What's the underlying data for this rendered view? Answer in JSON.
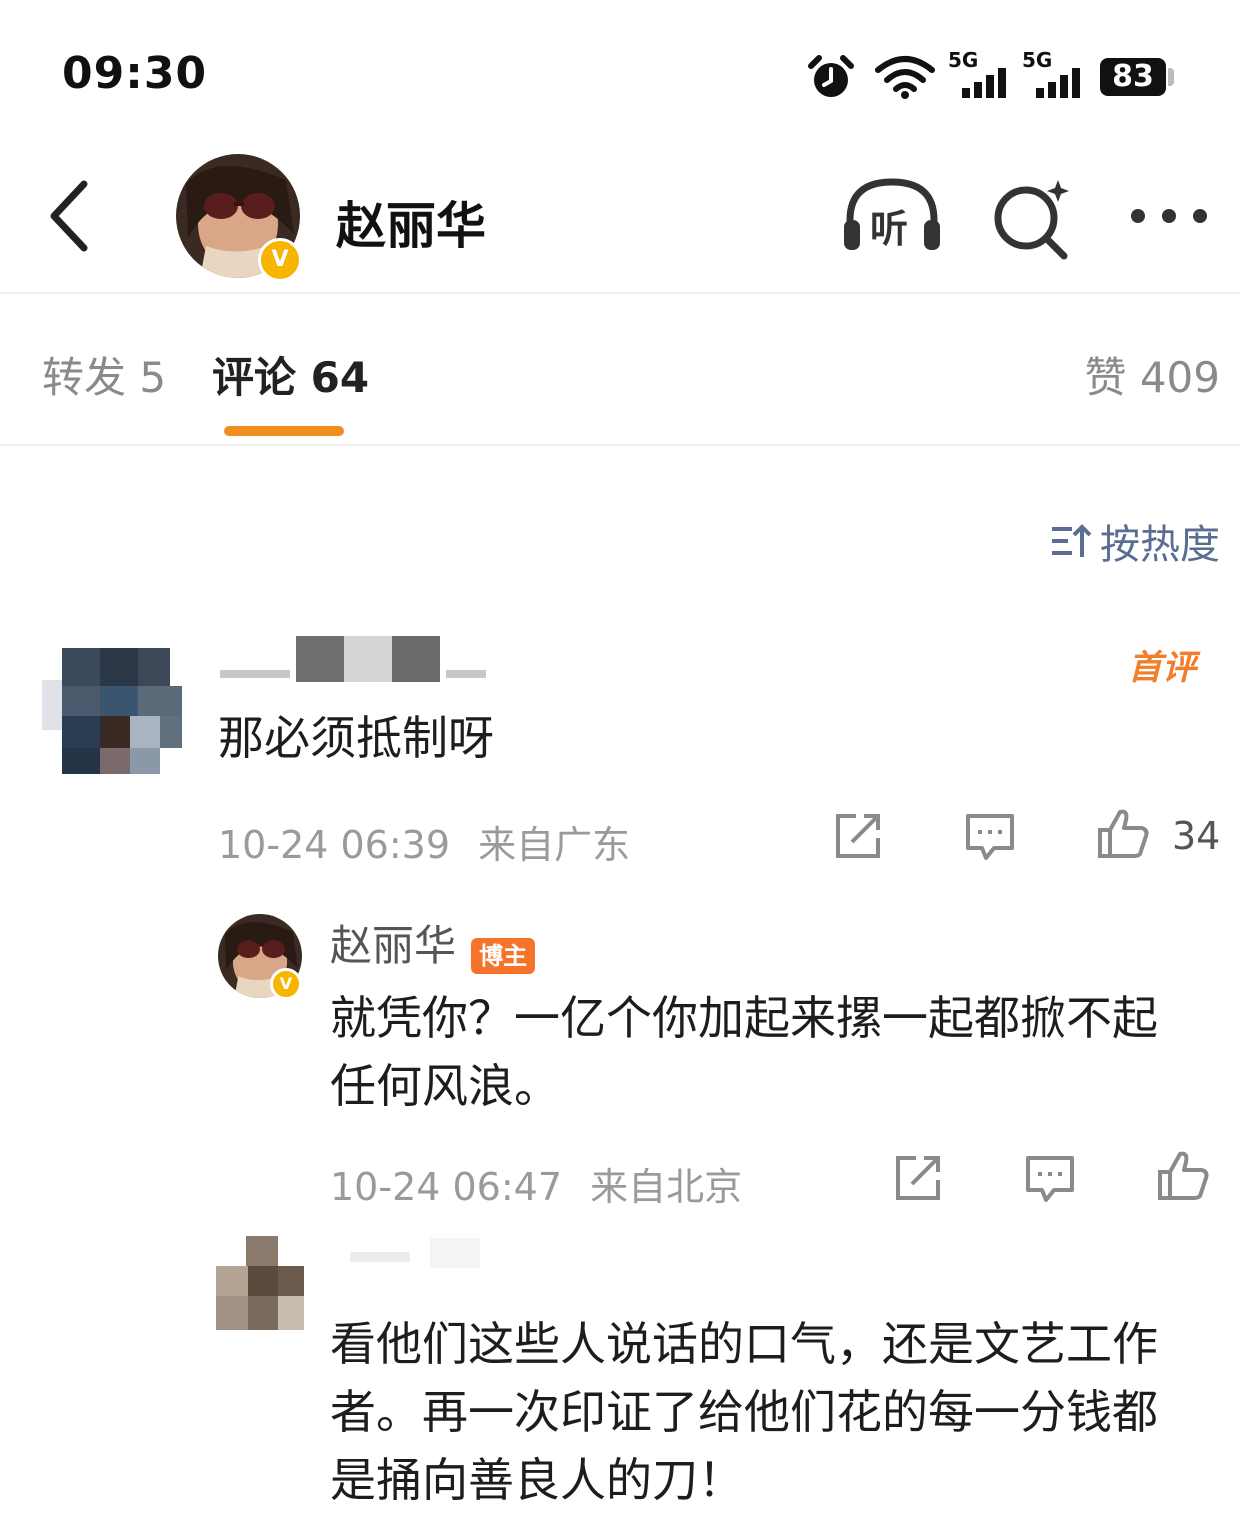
{
  "status_bar": {
    "time": "09:30",
    "battery": "83",
    "network1": "5G",
    "network2": "5G",
    "icons": [
      "alarm-icon",
      "wifi-icon",
      "signal-icon",
      "signal-icon",
      "battery-icon"
    ]
  },
  "header": {
    "title": "赵丽华",
    "verified_mark": "V",
    "listen_label": "听"
  },
  "tabs": {
    "repost": "转发 5",
    "comments": "评论 64",
    "likes": "赞 409"
  },
  "sort": {
    "label": "按热度"
  },
  "comments": [
    {
      "text": "那必须抵制呀",
      "badge": "首评",
      "time": "10-24 06:39",
      "location": "来自广东",
      "likes": "34"
    },
    {
      "author": "赵丽华",
      "author_badge": "博主",
      "text": "就凭你？一亿个你加起来摞一起都掀不起任何风浪。",
      "time": "10-24 06:47",
      "location": "来自北京",
      "likes": ""
    },
    {
      "text": "看他们这些人说话的口气，还是文艺工作者。再一次印证了给他们花的每一分钱都是捅向善良人的刀！"
    }
  ],
  "colors": {
    "accent": "#ef8f1f",
    "op_badge": "#f5732b",
    "sort_blue": "#5a6d93",
    "verified": "#f7b500"
  }
}
